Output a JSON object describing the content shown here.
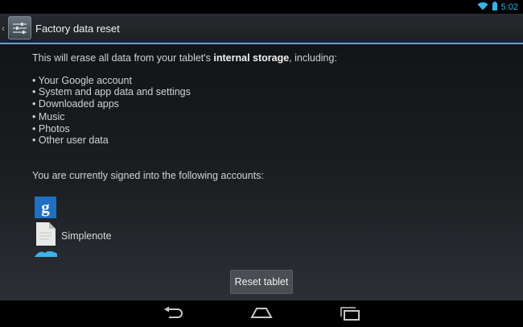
{
  "status_bar": {
    "time": "5:02",
    "icons": [
      "wifi-icon",
      "battery-icon"
    ]
  },
  "action_bar": {
    "title": "Factory data reset",
    "icon": "settings-icon"
  },
  "content": {
    "intro_prefix": "This will erase all data from your tablet's ",
    "intro_bold": "internal storage",
    "intro_suffix": ", including:",
    "bullets": [
      "Your Google account",
      "System and app data and settings",
      "Downloaded apps",
      "Music",
      "Photos",
      "Other user data"
    ],
    "signed_in_text": "You are currently signed into the following accounts:",
    "accounts": [
      {
        "name": "",
        "icon": "google-icon"
      },
      {
        "name": "Simplenote",
        "icon": "simplenote-icon"
      },
      {
        "name": "",
        "icon": "twitter-icon"
      }
    ]
  },
  "reset_button": {
    "label": "Reset tablet"
  },
  "nav_bar": {
    "buttons": [
      "back-icon",
      "home-icon",
      "recent-apps-icon"
    ]
  },
  "colors": {
    "accent": "#33b5e5",
    "google_blue": "#1f6fc2",
    "twitter_blue": "#3fb0e8"
  }
}
